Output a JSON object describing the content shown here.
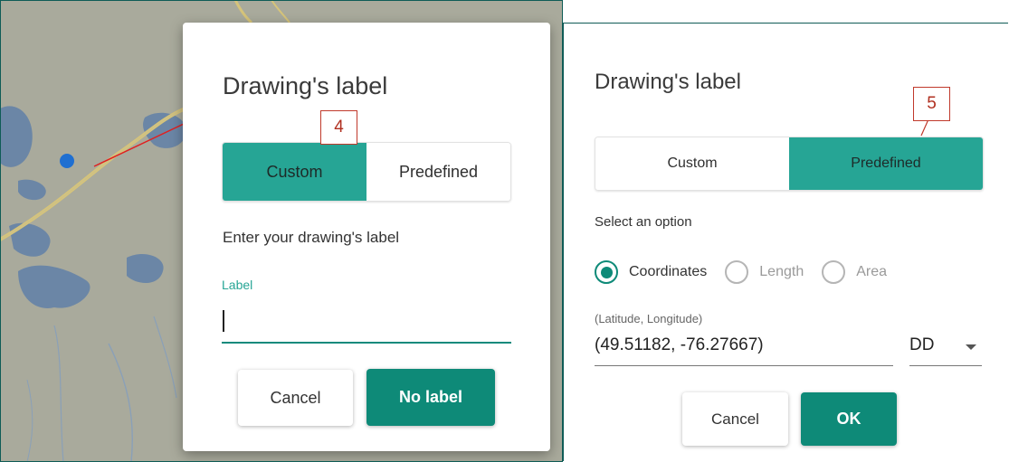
{
  "left": {
    "title": "Drawing's label",
    "tabs": [
      {
        "label": "Custom",
        "active": true
      },
      {
        "label": "Predefined",
        "active": false
      }
    ],
    "instructions": "Enter your drawing's label",
    "field_label": "Label",
    "field_value": "",
    "cancel_label": "Cancel",
    "primary_label": "No label",
    "step_badge": "4"
  },
  "right": {
    "title": "Drawing's label",
    "tabs": [
      {
        "label": "Custom",
        "active": false
      },
      {
        "label": "Predefined",
        "active": true
      }
    ],
    "select_label": "Select an option",
    "options": [
      {
        "label": "Coordinates",
        "checked": true
      },
      {
        "label": "Length",
        "checked": false
      },
      {
        "label": "Area",
        "checked": false
      }
    ],
    "coord_hint": "(Latitude, Longitude)",
    "coord_value": "(49.51182, -76.27667)",
    "format_value": "DD",
    "cancel_label": "Cancel",
    "ok_label": "OK",
    "step_badge": "5"
  },
  "colors": {
    "accent": "#26a595",
    "primary_button": "#0e8a78",
    "annotation": "#e02020",
    "map_land": "#a9aa9c",
    "map_water": "#6b86a6"
  },
  "icons": {
    "map_marker": "blue-dot-marker",
    "annotation_arrow": "red-arrow",
    "dropdown": "caret-down-icon"
  }
}
